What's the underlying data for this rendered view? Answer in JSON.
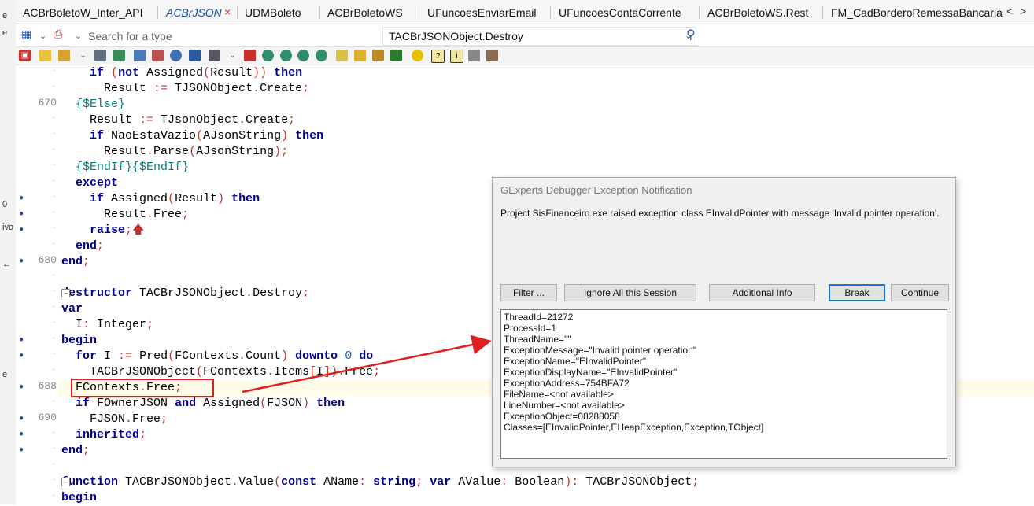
{
  "tabs": [
    {
      "label": "ACBrBoletoW_Inter_API",
      "active": false
    },
    {
      "label": "ACBrJSON",
      "active": true
    },
    {
      "label": "UDMBoleto",
      "active": false
    },
    {
      "label": "ACBrBoletoWS",
      "active": false
    },
    {
      "label": "UFuncoesEnviarEmail",
      "active": false
    },
    {
      "label": "UFuncoesContaCorrente",
      "active": false
    },
    {
      "label": "ACBrBoletoWS.Rest",
      "active": false
    },
    {
      "label": "FM_CadBorderoRemessaBancaria",
      "active": false
    }
  ],
  "tab_close_glyph": "×",
  "tab_scroll_left": "<",
  "tab_scroll_right": ">",
  "search": {
    "placeholder": "Search for a type",
    "method": "TACBrJSONObject.Destroy"
  },
  "left_strip": [
    "e",
    "e",
    "0",
    "ivo",
    "←",
    "e"
  ],
  "gutter": [
    {
      "num": "670",
      "dot": false
    },
    {
      "num": "680",
      "dot": true
    },
    {
      "num": "688",
      "dot": true
    },
    {
      "num": "690",
      "dot": true
    }
  ],
  "code_lines": [
    {
      "html": "    <span class='kw'>if</span> <span class='op'>(</span><span class='kw'>not</span> Assigned<span class='op'>(</span>Result<span class='op'>))</span> <span class='kw'>then</span>"
    },
    {
      "html": "      Result <span class='op'>:=</span> TJSONObject<span class='op'>.</span>Create<span class='op'>;</span>"
    },
    {
      "html": "  <span class='dir'>{$Else}</span>"
    },
    {
      "html": "    Result <span class='op'>:=</span> TJsonObject<span class='op'>.</span>Create<span class='op'>;</span>"
    },
    {
      "html": "    <span class='kw'>if</span> NaoEstaVazio<span class='op'>(</span>AJsonString<span class='op'>)</span> <span class='kw'>then</span>"
    },
    {
      "html": "      Result<span class='op'>.</span>Parse<span class='op'>(</span>AJsonString<span class='op'>);</span>"
    },
    {
      "html": "  <span class='dir'>{$EndIf}{$EndIf}</span>"
    },
    {
      "html": "  <span class='kw'>except</span>"
    },
    {
      "html": "    <span class='kw'>if</span> Assigned<span class='op'>(</span>Result<span class='op'>)</span> <span class='kw'>then</span>"
    },
    {
      "html": "      Result<span class='op'>.</span>Free<span class='op'>;</span>"
    },
    {
      "html": "    <span class='kw'>raise</span><span class='op'>;</span><span class='op'>🡅</span>"
    },
    {
      "html": "  <span class='kw'>end</span><span class='op'>;</span>"
    },
    {
      "html": "<span class='kw'>end</span><span class='op'>;</span>"
    },
    {
      "html": ""
    },
    {
      "html": "<span class='kw'>destructor</span> TACBrJSONObject<span class='op'>.</span>Destroy<span class='op'>;</span>"
    },
    {
      "html": "<span class='kw'>var</span>"
    },
    {
      "html": "  I<span class='op'>:</span> Integer<span class='op'>;</span>"
    },
    {
      "html": "<span class='kw'>begin</span>"
    },
    {
      "html": "  <span class='kw'>for</span> I <span class='op'>:=</span> Pred<span class='op'>(</span>FContexts<span class='op'>.</span>Count<span class='op'>)</span> <span class='kw'>downto</span> <span class='num'>0</span> <span class='kw'>do</span>"
    },
    {
      "html": "    TACBrJSONObject<span class='op'>(</span>FContexts<span class='op'>.</span>Items<span class='op'>[</span>I<span class='op'>]).</span>Free<span class='op'>;</span>"
    },
    {
      "html": "  FContexts<span class='op'>.</span>Free<span class='op'>;</span>"
    },
    {
      "html": "  <span class='kw'>if</span> FOwnerJSON <span class='kw'>and</span> Assigned<span class='op'>(</span>FJSON<span class='op'>)</span> <span class='kw'>then</span>"
    },
    {
      "html": "    FJSON<span class='op'>.</span>Free<span class='op'>;</span>"
    },
    {
      "html": "  <span class='kw'>inherited</span><span class='op'>;</span>"
    },
    {
      "html": "<span class='kw'>end</span><span class='op'>;</span>"
    },
    {
      "html": ""
    },
    {
      "html": "<span class='kw'>function</span> TACBrJSONObject<span class='op'>.</span>Value<span class='op'>(</span><span class='kw'>const</span> AName<span class='op'>:</span> <span class='kw'>string</span><span class='op'>;</span> <span class='kw'>var</span> AValue<span class='op'>:</span> Boolean<span class='op'>):</span> TACBrJSONObject<span class='op'>;</span>"
    },
    {
      "html": "<span class='kw'>begin</span>"
    }
  ],
  "dialog": {
    "title": "GExperts Debugger Exception Notification",
    "message": "Project SisFinanceiro.exe raised exception class EInvalidPointer with message 'Invalid pointer operation'.",
    "buttons": {
      "filter": "Filter ...",
      "ignore": "Ignore All this Session",
      "info": "Additional Info",
      "break": "Break",
      "continue": "Continue"
    },
    "details": "ThreadId=21272\nProcessId=1\nThreadName=\"\"\nExceptionMessage=\"Invalid pointer operation\"\nExceptionName=\"EInvalidPointer\"\nExceptionDisplayName=\"EInvalidPointer\"\nExceptionAddress=754BFA72\nFileName=<not available>\nLineNumber=<not available>\nExceptionObject=08288058\nClasses=[EInvalidPointer,EHeapException,Exception,TObject]"
  },
  "colors": {
    "keyword": "#00008b",
    "operator": "#c0342b",
    "directive": "#008080",
    "annotation": "#e02020",
    "default_button": "#1a73d9"
  }
}
